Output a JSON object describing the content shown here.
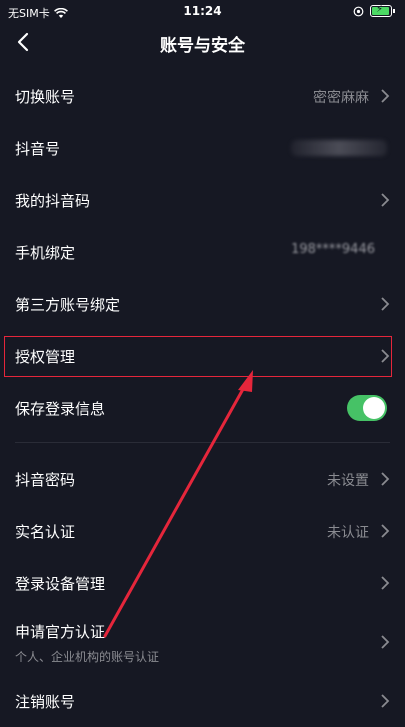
{
  "status_bar": {
    "carrier": "无SIM卡",
    "time": "11:24"
  },
  "nav": {
    "title": "账号与安全"
  },
  "rows": {
    "switch_account": {
      "label": "切换账号",
      "value": "密密麻麻"
    },
    "douyin_id": {
      "label": "抖音号"
    },
    "my_qr_code": {
      "label": "我的抖音码"
    },
    "phone_binding": {
      "label": "手机绑定",
      "value": "198****9446"
    },
    "third_party_binding": {
      "label": "第三方账号绑定"
    },
    "authorization": {
      "label": "授权管理"
    },
    "save_login": {
      "label": "保存登录信息",
      "enabled": true
    },
    "password": {
      "label": "抖音密码",
      "value": "未设置"
    },
    "real_name": {
      "label": "实名认证",
      "value": "未认证"
    },
    "login_devices": {
      "label": "登录设备管理"
    },
    "official_verify": {
      "label": "申请官方认证",
      "sub": "个人、企业机构的账号认证"
    },
    "deactivate": {
      "label": "注销账号"
    }
  },
  "colors": {
    "background": "#161823",
    "toggle_on": "#46c266",
    "highlight": "#e5263b",
    "secondary_text": "#8a8b91"
  }
}
